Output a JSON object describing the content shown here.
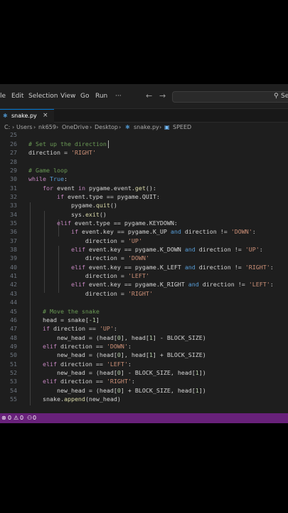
{
  "menu": {
    "items": [
      "le",
      "Edit",
      "Selection",
      "View",
      "Go",
      "Run",
      "···"
    ],
    "back_icon": "arrow-left-icon",
    "forward_icon": "arrow-right-icon",
    "search_text": "Se"
  },
  "tab": {
    "label": "snake.py",
    "close": "×"
  },
  "breadcrumb": {
    "drive": "C:",
    "users": "Users",
    "user": "nk659",
    "onedrive": "OneDrive",
    "desktop": "Desktop",
    "file": "snake.py",
    "symbol": "SPEED"
  },
  "editor": {
    "line_numbers": [
      "25",
      "26",
      "27",
      "28",
      "29",
      "30",
      "31",
      "32",
      "33",
      "34",
      "35",
      "36",
      "37",
      "38",
      "39",
      "40",
      "41",
      "42",
      "43",
      "44",
      "45",
      "46",
      "47",
      "48",
      "49",
      "50",
      "51",
      "52",
      "53",
      "54",
      "55"
    ]
  },
  "status": {
    "errors": "0",
    "warnings": "0",
    "ports": "0"
  },
  "colors": {
    "statusbar": "#68217a",
    "keyword": "#569cd6",
    "control": "#c586c0",
    "string": "#ce9178",
    "comment": "#6a9955"
  }
}
